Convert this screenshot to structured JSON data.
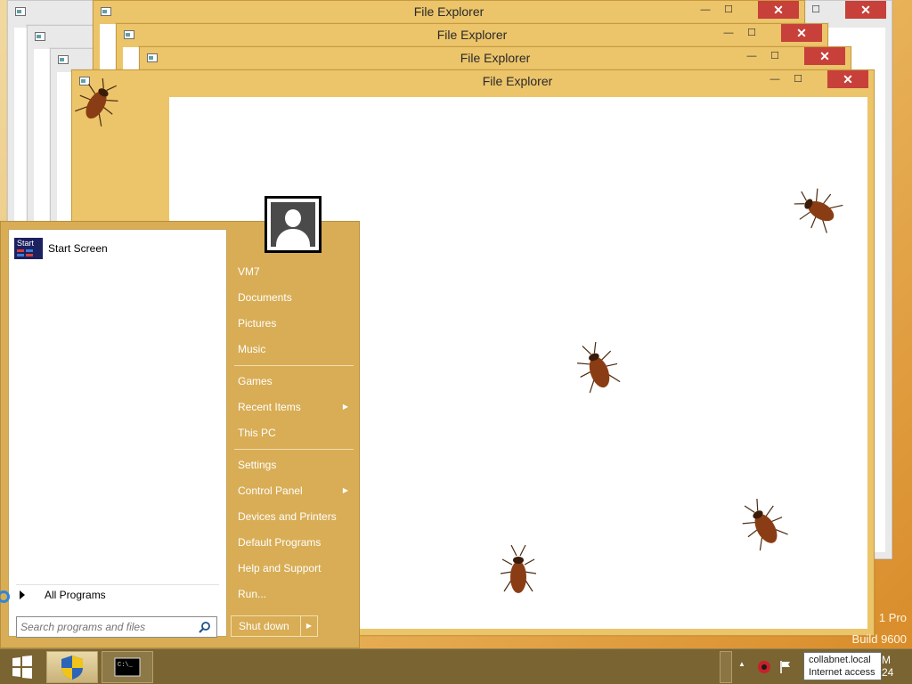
{
  "windows": [
    {
      "title": "File Explorer",
      "min": "—",
      "max": "☐",
      "close": "✕"
    },
    {
      "title": "File Explorer",
      "min": "—",
      "max": "☐",
      "close": "✕"
    },
    {
      "title": "File Explorer",
      "min": "—",
      "max": "☐",
      "close": "✕"
    },
    {
      "title": "File Explorer",
      "min": "—",
      "max": "☐",
      "close": "✕"
    }
  ],
  "back_window": {
    "min": "—",
    "max": "☐",
    "close": "✕"
  },
  "start_menu": {
    "start_screen_label": "Start Screen",
    "start_icon_text": "Start",
    "all_programs_label": "All Programs",
    "search_placeholder": "Search programs and files",
    "right_items": [
      {
        "label": "VM7",
        "arrow": ""
      },
      {
        "label": "Documents",
        "arrow": ""
      },
      {
        "label": "Pictures",
        "arrow": ""
      },
      {
        "label": "Music",
        "arrow": ""
      },
      {
        "label": "Games",
        "arrow": ""
      },
      {
        "label": "Recent Items",
        "arrow": "▶"
      },
      {
        "label": "This PC",
        "arrow": ""
      },
      {
        "label": "Settings",
        "arrow": ""
      },
      {
        "label": "Control Panel",
        "arrow": "▶"
      },
      {
        "label": "Devices and Printers",
        "arrow": ""
      },
      {
        "label": "Default Programs",
        "arrow": ""
      },
      {
        "label": "Help and Support",
        "arrow": ""
      },
      {
        "label": "Run...",
        "arrow": ""
      }
    ],
    "shutdown_label": "Shut down",
    "shutdown_more": "▶"
  },
  "desktop": {
    "watermark_line1": "1 Pro",
    "watermark_line2": "Build 9600"
  },
  "tray": {
    "up_arrow": "▲",
    "tooltip_line1": "collabnet.local",
    "tooltip_line2": "Internet access",
    "clock_line1": "M",
    "clock_line2": "24"
  },
  "colors": {
    "accent": "#d8ad55",
    "close": "#c7403a",
    "taskbar": "#7a6432"
  }
}
